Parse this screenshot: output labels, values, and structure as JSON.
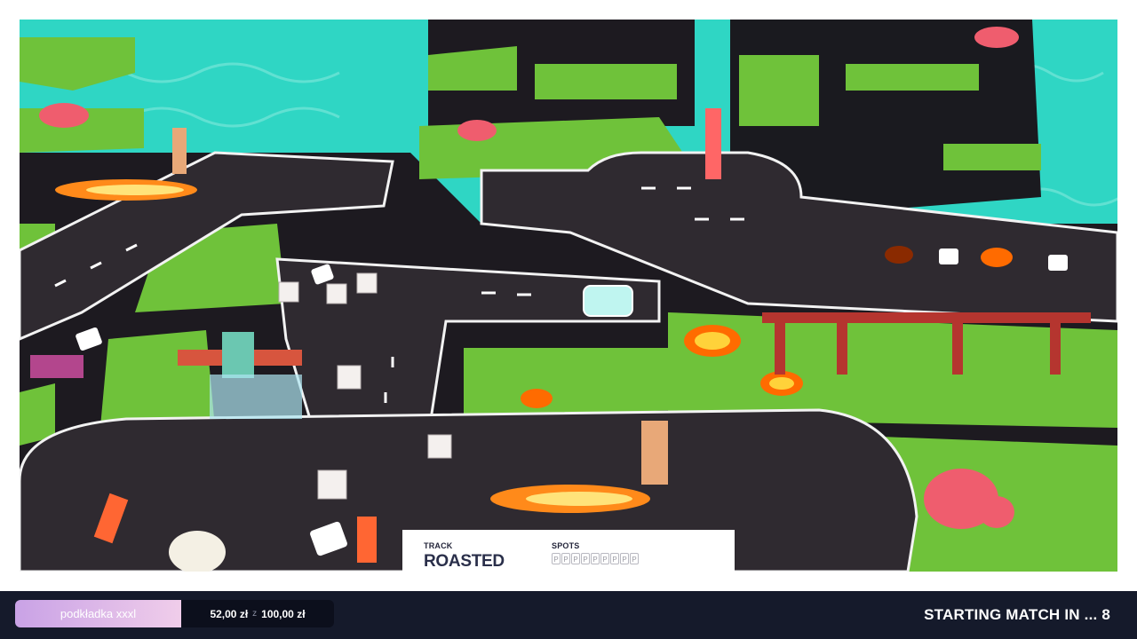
{
  "track_panel": {
    "track_label": "TRACK",
    "track_name": "ROASTED",
    "spots_label": "SPOTS",
    "spots": [
      "P",
      "P",
      "P",
      "P",
      "P",
      "P",
      "P",
      "P",
      "P"
    ]
  },
  "bottom_bar": {
    "player_name": "podkładka xxxl",
    "current_amount": "52,00 zł",
    "separator": "z",
    "goal_amount": "100,00 zł",
    "countdown_text": "STARTING MATCH IN ... 8"
  },
  "colors": {
    "water": "#2fd6c4",
    "road": "#2f2a30",
    "grass": "#6fc23a",
    "fire": "#ff8a1a",
    "bar_bg": "#151a2b",
    "pill_gradient_start": "#c9a2e6",
    "pill_gradient_end": "#f0cdea"
  }
}
